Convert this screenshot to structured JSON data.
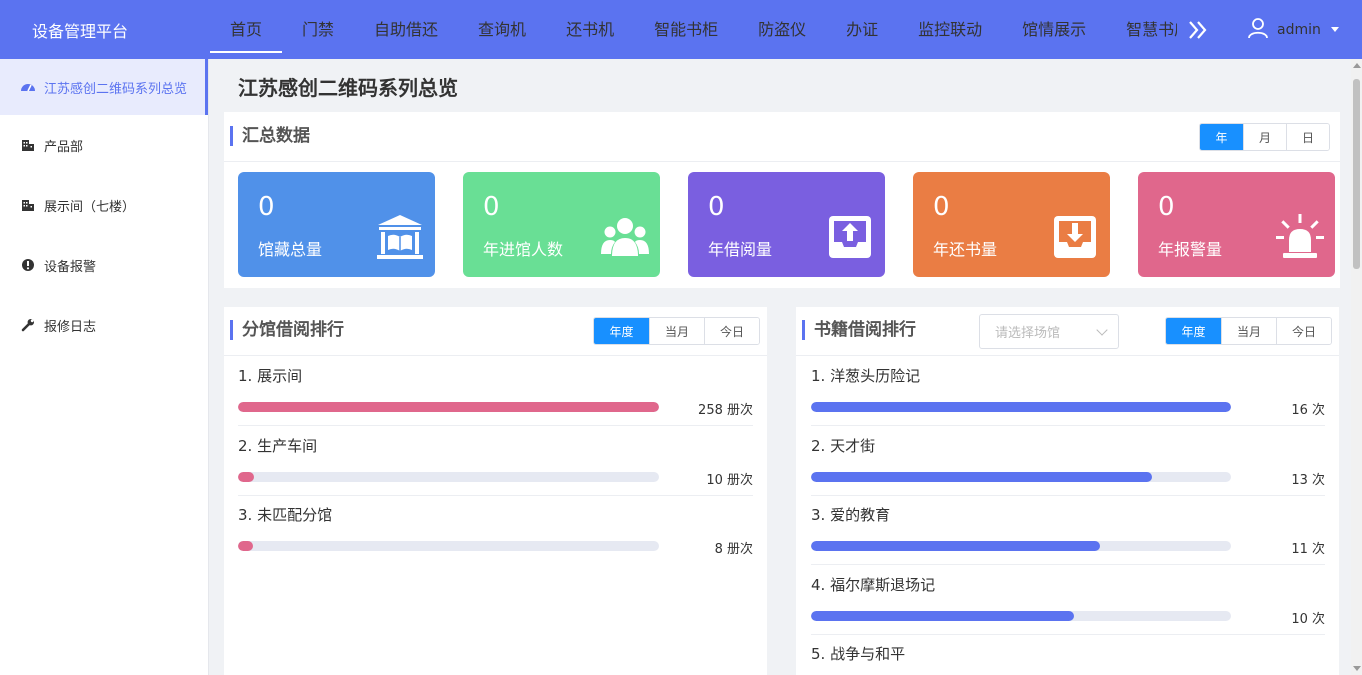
{
  "header": {
    "brand": "设备管理平台",
    "nav": [
      {
        "label": "首页",
        "active": true
      },
      {
        "label": "门禁"
      },
      {
        "label": "自助借还"
      },
      {
        "label": "查询机"
      },
      {
        "label": "还书机"
      },
      {
        "label": "智能书柜"
      },
      {
        "label": "防盗仪"
      },
      {
        "label": "办证"
      },
      {
        "label": "监控联动"
      },
      {
        "label": "馆情展示"
      },
      {
        "label": "智慧书店"
      }
    ],
    "user": "admin"
  },
  "sidebar": {
    "items": [
      {
        "label": "江苏感创二维码系列总览",
        "icon": "dashboard-icon",
        "active": true
      },
      {
        "label": "产品部",
        "icon": "building-icon"
      },
      {
        "label": "展示间（七楼）",
        "icon": "building-icon"
      },
      {
        "label": "设备报警",
        "icon": "alarm-icon"
      },
      {
        "label": "报修日志",
        "icon": "wrench-icon"
      }
    ]
  },
  "page": {
    "title": "江苏感创二维码系列总览"
  },
  "summary": {
    "title": "汇总数据",
    "periods": [
      "年",
      "月",
      "日"
    ],
    "stats": [
      {
        "value": "0",
        "label": "馆藏总量",
        "color": "#5091e9",
        "icon": "library-icon"
      },
      {
        "value": "0",
        "label": "年进馆人数",
        "color": "#69df95",
        "icon": "users-icon"
      },
      {
        "value": "0",
        "label": "年借阅量",
        "color": "#7a5fe0",
        "icon": "borrow-icon"
      },
      {
        "value": "0",
        "label": "年还书量",
        "color": "#ea7d44",
        "icon": "return-icon"
      },
      {
        "value": "0",
        "label": "年报警量",
        "color": "#e0678c",
        "icon": "siren-icon"
      }
    ]
  },
  "branch_rank": {
    "title": "分馆借阅排行",
    "periods": [
      "年度",
      "当月",
      "今日"
    ],
    "color": "#e0678c",
    "max": 258,
    "items": [
      {
        "name": "1. 展示间",
        "value": 258,
        "display": "258 册次"
      },
      {
        "name": "2. 生产车间",
        "value": 10,
        "display": "10 册次"
      },
      {
        "name": "3. 未匹配分馆",
        "value": 8,
        "display": "8 册次"
      }
    ]
  },
  "book_rank": {
    "title": "书籍借阅排行",
    "select_placeholder": "请选择场馆",
    "periods": [
      "年度",
      "当月",
      "今日"
    ],
    "color": "#5b73f0",
    "max": 16,
    "items": [
      {
        "name": "1. 洋葱头历险记",
        "value": 16,
        "display": "16 次"
      },
      {
        "name": "2. 天才街",
        "value": 13,
        "display": "13 次"
      },
      {
        "name": "3. 爱的教育",
        "value": 11,
        "display": "11 次"
      },
      {
        "name": "4. 福尔摩斯退场记",
        "value": 10,
        "display": "10 次"
      },
      {
        "name": "5. 战争与和平"
      }
    ]
  }
}
